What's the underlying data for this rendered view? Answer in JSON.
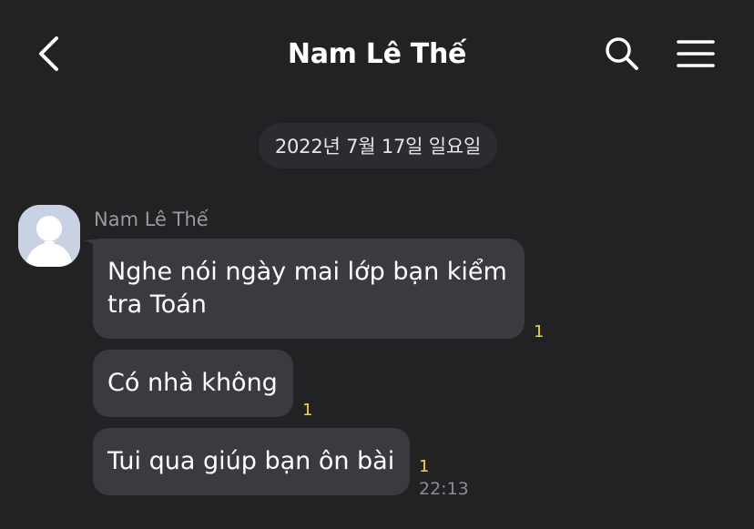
{
  "header": {
    "title": "Nam Lê Thế"
  },
  "date_divider": "2022년 7월 17일 일요일",
  "sender": {
    "name": "Nam Lê Thế"
  },
  "messages": [
    {
      "text": "Nghe nói ngày mai lớp bạn kiểm tra Toán",
      "unread": "1"
    },
    {
      "text": "Có nhà không",
      "unread": "1"
    },
    {
      "text": "Tui qua giúp bạn ôn bài",
      "unread": "1",
      "time": "22:13"
    }
  ],
  "icons": {
    "back": "chevron-left-icon",
    "search": "search-icon",
    "menu": "hamburger-menu-icon",
    "avatar": "default-user-avatar"
  },
  "colors": {
    "background": "#222225",
    "bubble": "#3b3b3f",
    "unread": "#f2d43a",
    "secondary_text": "#9a9a9e"
  }
}
